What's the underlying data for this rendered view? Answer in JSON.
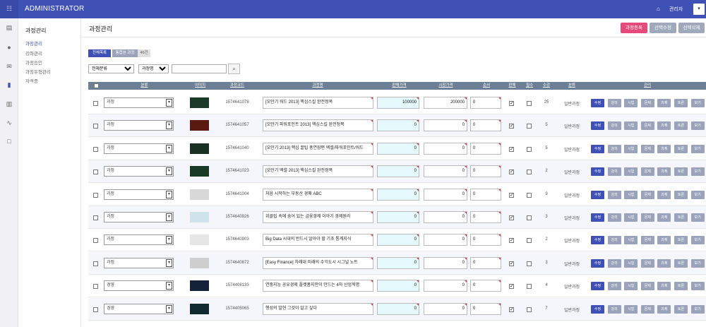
{
  "topbar": {
    "menu_icon": "grid-icon",
    "brand": "ADMINISTRATOR",
    "home_icon": "home-icon",
    "user": "관리자",
    "dropdown": "▾"
  },
  "iconbar": {
    "icons": [
      "server-icon",
      "user-icon",
      "chat-icon",
      "book-icon",
      "bar-chart-icon",
      "line-chart-icon",
      "square-icon"
    ]
  },
  "sidebar": {
    "title": "과정관리",
    "items": [
      "과정관리",
      "강좌관리",
      "과정승인",
      "과정유형관리",
      "자격증"
    ]
  },
  "page": {
    "title": "과정관리",
    "btn_add": "과정등록",
    "btn_edit": "선택수정",
    "btn_delete": "선택삭제",
    "colors": {
      "pink": "#e64a7a",
      "gray": "#a0a8bc",
      "accent": "#3f51b5"
    }
  },
  "tabs": {
    "all": "전체목록",
    "view": "통합본 과정",
    "count": "46건"
  },
  "filters": {
    "category": "전체분류",
    "sort": "과정명",
    "search_value": "",
    "search_icon": "search-icon"
  },
  "table": {
    "headers": [
      "",
      "분류",
      "이미지",
      "과정코드",
      "과정명",
      "판매가격",
      "시장가격",
      "순서",
      "판매",
      "필수",
      "수강",
      "분류",
      "관리"
    ],
    "actions": [
      "수정",
      "강의",
      "시험",
      "문제",
      "과제",
      "토론",
      "보기"
    ],
    "rows": [
      {
        "cat": "과정",
        "code": "1574641078",
        "name": "[오만기 워드 2013] 핵심스킬 완전정복",
        "sale": "100000",
        "market": "200000",
        "order": "0",
        "sell": true,
        "req": false,
        "cnt": "25",
        "type": "일반과정",
        "thumb": "#1c3a2a"
      },
      {
        "cat": "과정",
        "code": "1574641057",
        "name": "[오만기 파워포인트 2013] 핵심스킬 완전정복",
        "sale": "0",
        "market": "0",
        "order": "0",
        "sell": true,
        "req": false,
        "cnt": "5",
        "type": "일반과정",
        "thumb": "#5a1a12"
      },
      {
        "cat": "과정",
        "code": "1574641040",
        "name": "[오만기 2013] 핵심 꿀팁 총연장편 엑셀/파워포인트/워드",
        "sale": "0",
        "market": "0",
        "order": "0",
        "sell": true,
        "req": false,
        "cnt": "5",
        "type": "일반과정",
        "thumb": "#1a3022"
      },
      {
        "cat": "과정",
        "code": "1574641023",
        "name": "[오만기 엑셀 2013] 핵심스킬 완전정복",
        "sale": "0",
        "market": "0",
        "order": "0",
        "sell": true,
        "req": false,
        "cnt": "2",
        "type": "일반과정",
        "thumb": "#183a24"
      },
      {
        "cat": "과정",
        "code": "1574641004",
        "name": "처음 시작하는 부동산 경매 ABC",
        "sale": "0",
        "market": "0",
        "order": "0",
        "sell": true,
        "req": false,
        "cnt": "9",
        "type": "일반과정",
        "thumb": "#d8d8d8"
      },
      {
        "cat": "과정",
        "code": "1574640926",
        "name": "위클립 속에 숨어 있는 금융경제 이야기 경제원리",
        "sale": "0",
        "market": "0",
        "order": "0",
        "sell": true,
        "req": false,
        "cnt": "3",
        "type": "일반과정",
        "thumb": "#cfe3ea"
      },
      {
        "cat": "과정",
        "code": "1574640903",
        "name": "Big Data 시대의 반드시 알아야 할 기초 통계지식",
        "sale": "0",
        "market": "0",
        "order": "0",
        "sell": true,
        "req": false,
        "cnt": "2",
        "type": "일반과정",
        "thumb": "#e6e6e6"
      },
      {
        "cat": "과정",
        "code": "1574640872",
        "name": "[Easy Finance] 차례대 미래의 수익도시 시그널 노트",
        "sale": "0",
        "market": "0",
        "order": "0",
        "sell": true,
        "req": false,
        "cnt": "3",
        "type": "일반과정",
        "thumb": "#cfcfcf"
      },
      {
        "cat": "경영",
        "code": "1574408133",
        "name": "연중지능 공유경제 플랫폼지만이 만드는 4차 산업혁명",
        "sale": "0",
        "market": "0",
        "order": "0",
        "sell": true,
        "req": false,
        "cnt": "4",
        "type": "일반과정",
        "thumb": "#132238"
      },
      {
        "cat": "경영",
        "code": "1574405065",
        "name": "행성의 발현 그것이 알고 싶다",
        "sale": "0",
        "market": "0",
        "order": "0",
        "sell": true,
        "req": false,
        "cnt": "7",
        "type": "일반과정",
        "thumb": "#102a30"
      }
    ]
  }
}
